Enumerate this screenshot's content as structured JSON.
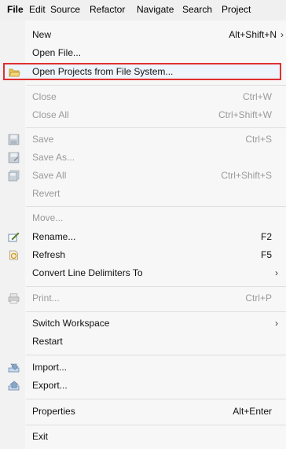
{
  "menubar": {
    "items": [
      "File",
      "Edit",
      "Source",
      "Refactor",
      "Navigate",
      "Search",
      "Project"
    ]
  },
  "menu": {
    "new_label": "New",
    "new_shortcut": "Alt+Shift+N",
    "open_file_label": "Open File...",
    "open_projects_label": "Open Projects from File System...",
    "close_label": "Close",
    "close_shortcut": "Ctrl+W",
    "close_all_label": "Close All",
    "close_all_shortcut": "Ctrl+Shift+W",
    "save_label": "Save",
    "save_shortcut": "Ctrl+S",
    "save_as_label": "Save As...",
    "save_all_label": "Save All",
    "save_all_shortcut": "Ctrl+Shift+S",
    "revert_label": "Revert",
    "move_label": "Move...",
    "rename_label": "Rename...",
    "rename_shortcut": "F2",
    "refresh_label": "Refresh",
    "refresh_shortcut": "F5",
    "convert_label": "Convert Line Delimiters To",
    "print_label": "Print...",
    "print_shortcut": "Ctrl+P",
    "switch_workspace_label": "Switch Workspace",
    "restart_label": "Restart",
    "import_label": "Import...",
    "export_label": "Export...",
    "properties_label": "Properties",
    "properties_shortcut": "Alt+Enter",
    "exit_label": "Exit"
  },
  "icons": {
    "open_projects": "folder-icon",
    "save": "save-icon",
    "save_as": "save-as-icon",
    "save_all": "save-all-icon",
    "rename": "rename-icon",
    "refresh": "refresh-icon",
    "print": "printer-icon",
    "import": "import-icon",
    "export": "export-icon",
    "submenu": "chevron-right-icon"
  },
  "colors": {
    "highlight_border": "#e03030",
    "disabled_text": "#9a9a9a"
  }
}
